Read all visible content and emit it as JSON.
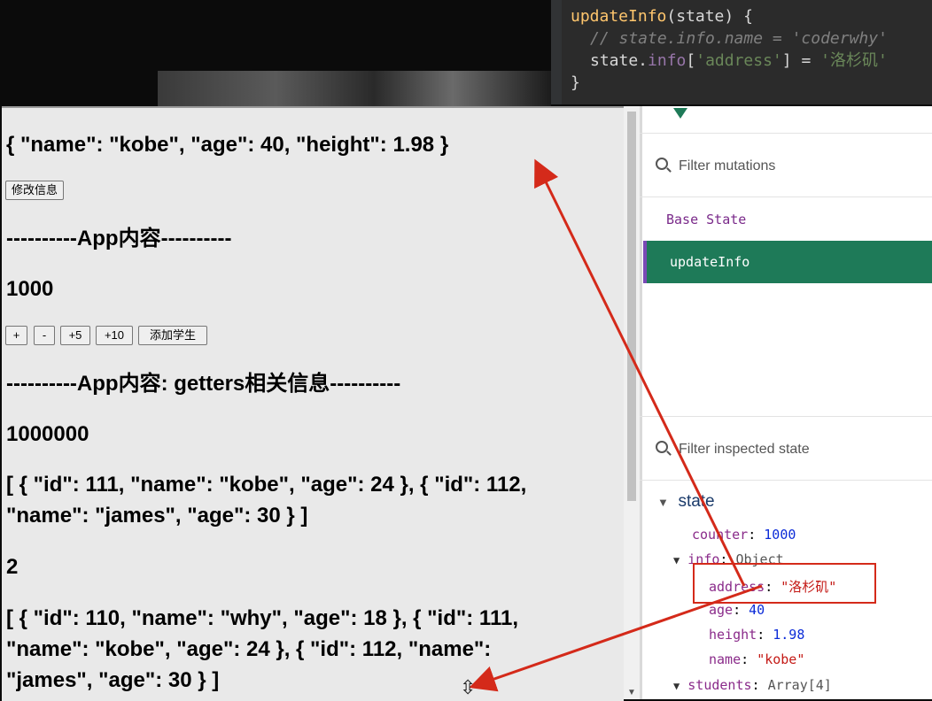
{
  "code": {
    "line1_fn": "updateInfo",
    "line1_rest": "(state) {",
    "line2_comment": "// state.info.name = 'coderwhy'",
    "line3_lhs": "state.",
    "line3_prop": "info",
    "line3_key": "'address'",
    "line3_mid": "] = ",
    "line3_val": "'洛杉矶'",
    "line4": "}"
  },
  "page": {
    "info_json": "{ \"name\": \"kobe\", \"age\": 40, \"height\": 1.98 }",
    "modify_button": "修改信息",
    "app_heading": "----------App内容----------",
    "counter": "1000",
    "buttons": [
      "+",
      "-",
      "+5",
      "+10",
      "添加学生"
    ],
    "getters_heading": "----------App内容: getters相关信息----------",
    "power_counter": "1000000",
    "students_filtered": "[ { \"id\": 111, \"name\": \"kobe\", \"age\": 24 }, { \"id\": 112, \"name\": \"james\", \"age\": 30 } ]",
    "count": "2",
    "students_all": "[ { \"id\": 110, \"name\": \"why\", \"age\": 18 }, { \"id\": 111, \"name\": \"kobe\", \"age\": 24 }, { \"id\": 112, \"name\": \"james\", \"age\": 30 } ]"
  },
  "devtools": {
    "filter_mutations_placeholder": "Filter mutations",
    "mutations": [
      "Base State",
      "updateInfo"
    ],
    "filter_state_placeholder": "Filter inspected state",
    "state_label": "state",
    "counter_key": "counter",
    "counter_value": "1000",
    "info_key": "info",
    "info_type": "Object",
    "address_key": "address",
    "address_value": "\"洛杉矶\"",
    "age_key": "age",
    "age_value": "40",
    "height_key": "height",
    "height_value": "1.98",
    "name_key": "name",
    "name_value": "\"kobe\"",
    "students_key": "students",
    "students_type": "Array[4]",
    "accent_color": "#1e7a58",
    "annotation_color": "#d42a1a"
  }
}
